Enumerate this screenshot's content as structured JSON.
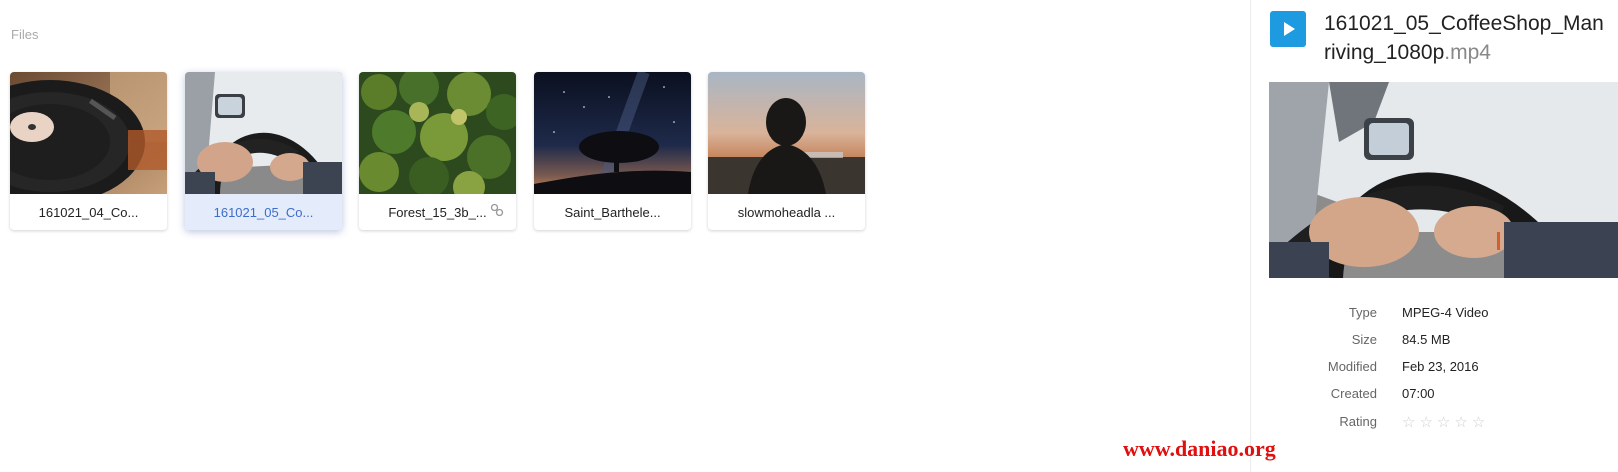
{
  "files": {
    "section_label": "Files",
    "items": [
      {
        "caption": "161021_04_Co...",
        "selected": false
      },
      {
        "caption": "161021_05_Co...",
        "selected": true
      },
      {
        "caption": "Forest_15_3b_...",
        "selected": false,
        "linked": true
      },
      {
        "caption": "Saint_Barthele...",
        "selected": false
      },
      {
        "caption": "slowmoheadla ...",
        "selected": false
      }
    ]
  },
  "details": {
    "title_line1": "161021_05_CoffeeShop_Man",
    "title_line2": "riving_1080p",
    "title_ext": ".mp4",
    "icon": "play-icon",
    "accent_color": "#1e9be0",
    "meta": [
      {
        "label": "Type",
        "value": "MPEG-4 Video"
      },
      {
        "label": "Size",
        "value": "84.5 MB"
      },
      {
        "label": "Modified",
        "value": "Feb 23, 2016"
      },
      {
        "label": "Created",
        "value": "07:00"
      }
    ],
    "rating_label": "Rating",
    "rating_value": 0,
    "rating_max": 5
  },
  "watermark": "www.daniao.org"
}
